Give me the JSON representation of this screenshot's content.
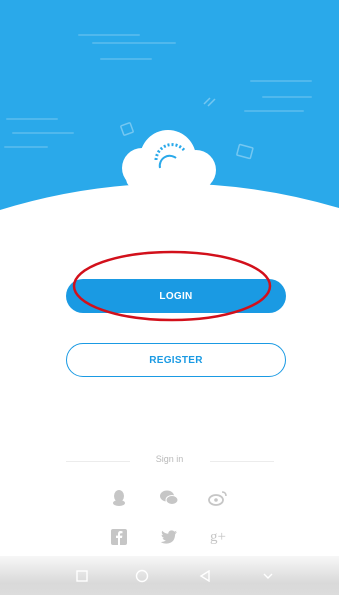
{
  "colors": {
    "primary_blue": "#1a9ae3",
    "header_blue": "#2aa9ea",
    "annotation_red": "#d2101b",
    "icon_gray": "#c6c6c6"
  },
  "buttons": {
    "login_label": "LOGIN",
    "register_label": "REGISTER"
  },
  "signin": {
    "label": "Sign in"
  },
  "social": [
    {
      "icon": "qq-icon"
    },
    {
      "icon": "wechat-icon"
    },
    {
      "icon": "weibo-icon"
    },
    {
      "icon": "facebook-icon"
    },
    {
      "icon": "twitter-icon"
    },
    {
      "icon": "google-plus-icon",
      "label": "g+"
    }
  ],
  "nav": [
    {
      "icon": "recent-apps-icon"
    },
    {
      "icon": "home-icon"
    },
    {
      "icon": "back-icon"
    },
    {
      "icon": "menu-down-icon"
    }
  ]
}
